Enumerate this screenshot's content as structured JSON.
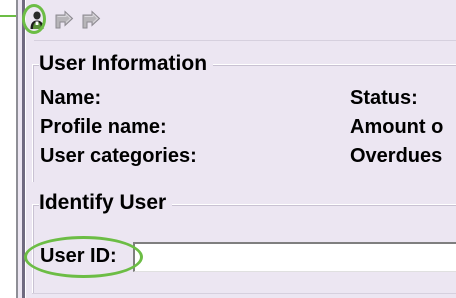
{
  "toolbar": {
    "buttons": [
      {
        "icon": "identify-user-icon",
        "state": "active"
      },
      {
        "icon": "forward-arrow-icon",
        "state": "disabled"
      },
      {
        "icon": "forward-arrow-alt-icon",
        "state": "disabled"
      }
    ]
  },
  "user_information": {
    "title": "User Information",
    "name_label": "Name:",
    "profile_name_label": "Profile name:",
    "user_categories_label": "User categories:",
    "status_label": "Status:",
    "amount_label": "Amount o",
    "overdues_label": "Overdues"
  },
  "identify_user": {
    "title": "Identify User",
    "user_id_label": "User ID:",
    "user_id_value": ""
  },
  "colors": {
    "background": "#ece6f2",
    "highlight": "#6cbd45"
  }
}
